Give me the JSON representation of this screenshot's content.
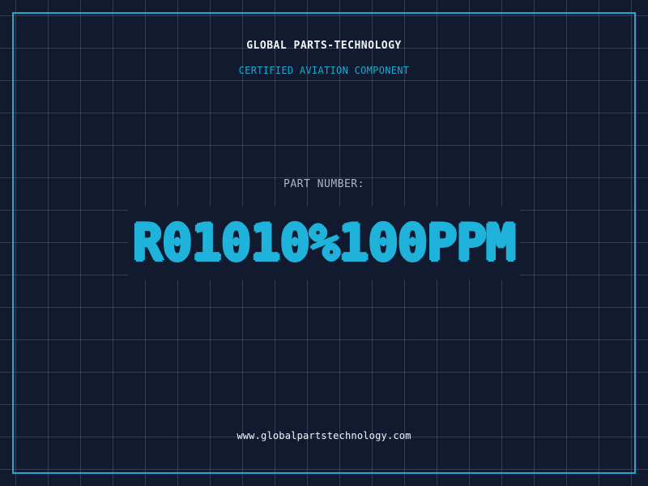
{
  "header": {
    "brand": "GLOBAL PARTS-TECHNOLOGY",
    "subtitle": "CERTIFIED AVIATION COMPONENT"
  },
  "part": {
    "label": "PART NUMBER:",
    "number": "R01010%100PPM"
  },
  "footer": {
    "url": "www.globalpartstechnology.com"
  },
  "colors": {
    "background": "#111a2e",
    "grid": "#1e6e8c",
    "accent": "#1da9d1",
    "text": "#f2f4f7",
    "muted": "#aeb6c2"
  }
}
